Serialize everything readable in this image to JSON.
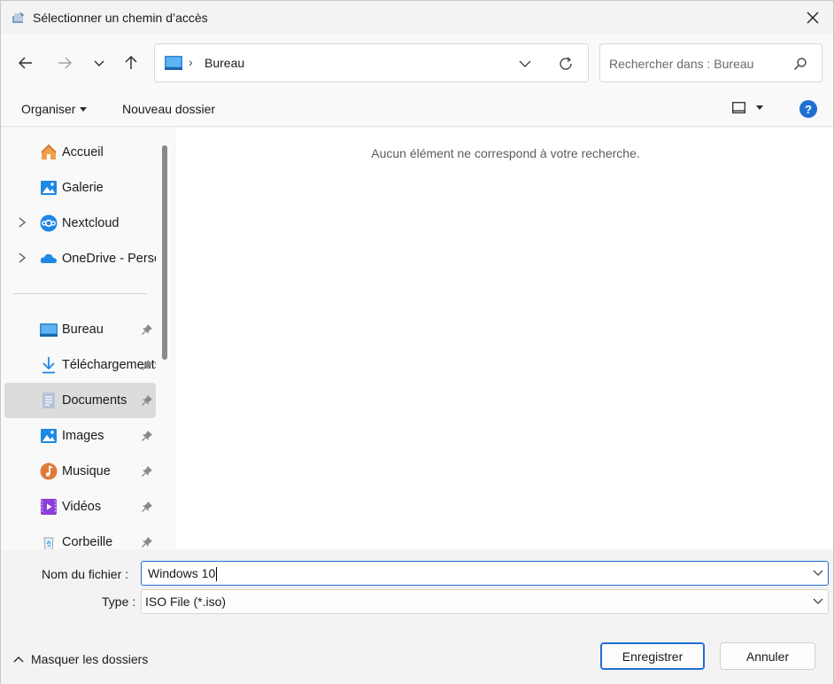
{
  "window": {
    "title": "Sélectionner un chemin d’accès"
  },
  "address": {
    "path_separator": "›",
    "current_folder": "Bureau"
  },
  "search": {
    "placeholder": "Rechercher dans : Bureau"
  },
  "toolbar": {
    "organize_label": "Organiser",
    "new_folder_label": "Nouveau dossier",
    "help_label": "?"
  },
  "sidebar": {
    "items": [
      {
        "label": "Accueil",
        "icon": "home-icon",
        "expandable": false,
        "pinned": false
      },
      {
        "label": "Galerie",
        "icon": "gallery-icon",
        "expandable": false,
        "pinned": false
      },
      {
        "label": "Nextcloud",
        "icon": "nextcloud-icon",
        "expandable": true,
        "pinned": false
      },
      {
        "label": "OneDrive - Perso",
        "icon": "onedrive-icon",
        "expandable": true,
        "pinned": false
      },
      {
        "label": "Bureau",
        "icon": "desktop-icon",
        "expandable": false,
        "pinned": true
      },
      {
        "label": "Téléchargements",
        "icon": "download-icon",
        "expandable": false,
        "pinned": true
      },
      {
        "label": "Documents",
        "icon": "documents-icon",
        "expandable": false,
        "pinned": true,
        "selected": true
      },
      {
        "label": "Images",
        "icon": "images-icon",
        "expandable": false,
        "pinned": true
      },
      {
        "label": "Musique",
        "icon": "music-icon",
        "expandable": false,
        "pinned": true
      },
      {
        "label": "Vidéos",
        "icon": "videos-icon",
        "expandable": false,
        "pinned": true
      },
      {
        "label": "Corbeille",
        "icon": "recycle-bin-icon",
        "expandable": false,
        "pinned": true
      }
    ]
  },
  "content": {
    "empty_message": "Aucun élément ne correspond à votre recherche."
  },
  "form": {
    "filename_label": "Nom du fichier :",
    "filename_value": "Windows 10",
    "type_label": "Type :",
    "type_value": "ISO File (*.iso)"
  },
  "footer": {
    "hide_folders_label": "Masquer les dossiers",
    "save_label": "Enregistrer",
    "cancel_label": "Annuler"
  },
  "colors": {
    "accent": "#1f6fd1",
    "selected_bg": "#dcdcdc",
    "window_bg": "#f3f3f3"
  }
}
